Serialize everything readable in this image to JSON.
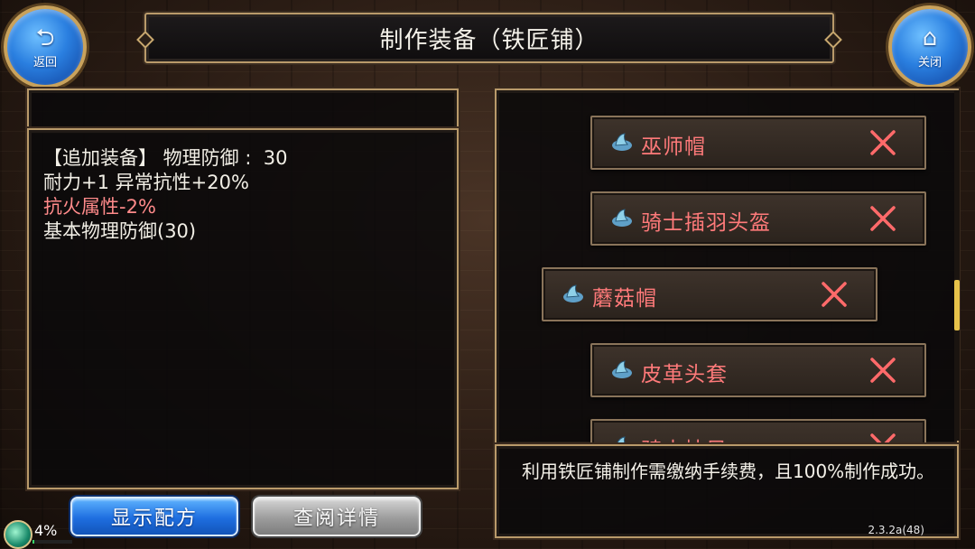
{
  "title": "制作装备（铁匠铺）",
  "nav": {
    "back_label": "返回",
    "close_label": "关闭"
  },
  "stats": {
    "line1": "【追加装备】 物理防御 :  30",
    "line2": "耐力+1 异常抗性+20%",
    "line3": "抗火属性-2%",
    "line4": "基本物理防御(30)"
  },
  "items": [
    {
      "name": "巫师帽"
    },
    {
      "name": "骑士插羽头盔"
    },
    {
      "name": "蘑菇帽"
    },
    {
      "name": "皮革头套"
    },
    {
      "name": "骑士披风"
    }
  ],
  "info": "利用铁匠铺制作需缴纳手续费，且100%制作成功。",
  "buttons": {
    "recipe_label": "显示配方",
    "detail_label": "查阅详情"
  },
  "status": {
    "percent_label": "4%",
    "progress": 0.04,
    "version": "2.3.2a(48)"
  },
  "colors": {
    "accent_red": "#ff7a7a",
    "button_blue": "#1e6ee0",
    "frame_gold": "#b99a6a"
  }
}
